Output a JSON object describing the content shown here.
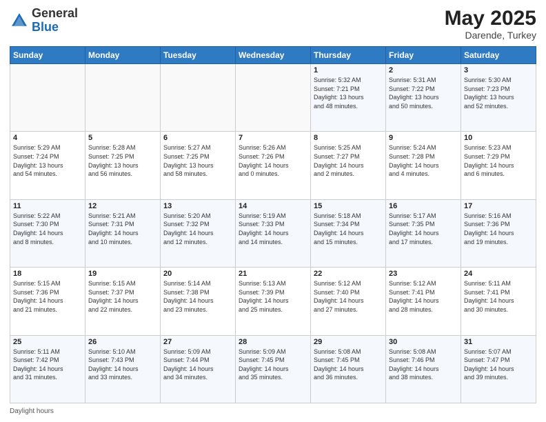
{
  "header": {
    "logo_general": "General",
    "logo_blue": "Blue",
    "title": "May 2025",
    "location": "Darende, Turkey"
  },
  "days_of_week": [
    "Sunday",
    "Monday",
    "Tuesday",
    "Wednesday",
    "Thursday",
    "Friday",
    "Saturday"
  ],
  "weeks": [
    [
      {
        "day": "",
        "info": ""
      },
      {
        "day": "",
        "info": ""
      },
      {
        "day": "",
        "info": ""
      },
      {
        "day": "",
        "info": ""
      },
      {
        "day": "1",
        "info": "Sunrise: 5:32 AM\nSunset: 7:21 PM\nDaylight: 13 hours\nand 48 minutes."
      },
      {
        "day": "2",
        "info": "Sunrise: 5:31 AM\nSunset: 7:22 PM\nDaylight: 13 hours\nand 50 minutes."
      },
      {
        "day": "3",
        "info": "Sunrise: 5:30 AM\nSunset: 7:23 PM\nDaylight: 13 hours\nand 52 minutes."
      }
    ],
    [
      {
        "day": "4",
        "info": "Sunrise: 5:29 AM\nSunset: 7:24 PM\nDaylight: 13 hours\nand 54 minutes."
      },
      {
        "day": "5",
        "info": "Sunrise: 5:28 AM\nSunset: 7:25 PM\nDaylight: 13 hours\nand 56 minutes."
      },
      {
        "day": "6",
        "info": "Sunrise: 5:27 AM\nSunset: 7:25 PM\nDaylight: 13 hours\nand 58 minutes."
      },
      {
        "day": "7",
        "info": "Sunrise: 5:26 AM\nSunset: 7:26 PM\nDaylight: 14 hours\nand 0 minutes."
      },
      {
        "day": "8",
        "info": "Sunrise: 5:25 AM\nSunset: 7:27 PM\nDaylight: 14 hours\nand 2 minutes."
      },
      {
        "day": "9",
        "info": "Sunrise: 5:24 AM\nSunset: 7:28 PM\nDaylight: 14 hours\nand 4 minutes."
      },
      {
        "day": "10",
        "info": "Sunrise: 5:23 AM\nSunset: 7:29 PM\nDaylight: 14 hours\nand 6 minutes."
      }
    ],
    [
      {
        "day": "11",
        "info": "Sunrise: 5:22 AM\nSunset: 7:30 PM\nDaylight: 14 hours\nand 8 minutes."
      },
      {
        "day": "12",
        "info": "Sunrise: 5:21 AM\nSunset: 7:31 PM\nDaylight: 14 hours\nand 10 minutes."
      },
      {
        "day": "13",
        "info": "Sunrise: 5:20 AM\nSunset: 7:32 PM\nDaylight: 14 hours\nand 12 minutes."
      },
      {
        "day": "14",
        "info": "Sunrise: 5:19 AM\nSunset: 7:33 PM\nDaylight: 14 hours\nand 14 minutes."
      },
      {
        "day": "15",
        "info": "Sunrise: 5:18 AM\nSunset: 7:34 PM\nDaylight: 14 hours\nand 15 minutes."
      },
      {
        "day": "16",
        "info": "Sunrise: 5:17 AM\nSunset: 7:35 PM\nDaylight: 14 hours\nand 17 minutes."
      },
      {
        "day": "17",
        "info": "Sunrise: 5:16 AM\nSunset: 7:36 PM\nDaylight: 14 hours\nand 19 minutes."
      }
    ],
    [
      {
        "day": "18",
        "info": "Sunrise: 5:15 AM\nSunset: 7:36 PM\nDaylight: 14 hours\nand 21 minutes."
      },
      {
        "day": "19",
        "info": "Sunrise: 5:15 AM\nSunset: 7:37 PM\nDaylight: 14 hours\nand 22 minutes."
      },
      {
        "day": "20",
        "info": "Sunrise: 5:14 AM\nSunset: 7:38 PM\nDaylight: 14 hours\nand 23 minutes."
      },
      {
        "day": "21",
        "info": "Sunrise: 5:13 AM\nSunset: 7:39 PM\nDaylight: 14 hours\nand 25 minutes."
      },
      {
        "day": "22",
        "info": "Sunrise: 5:12 AM\nSunset: 7:40 PM\nDaylight: 14 hours\nand 27 minutes."
      },
      {
        "day": "23",
        "info": "Sunrise: 5:12 AM\nSunset: 7:41 PM\nDaylight: 14 hours\nand 28 minutes."
      },
      {
        "day": "24",
        "info": "Sunrise: 5:11 AM\nSunset: 7:41 PM\nDaylight: 14 hours\nand 30 minutes."
      }
    ],
    [
      {
        "day": "25",
        "info": "Sunrise: 5:11 AM\nSunset: 7:42 PM\nDaylight: 14 hours\nand 31 minutes."
      },
      {
        "day": "26",
        "info": "Sunrise: 5:10 AM\nSunset: 7:43 PM\nDaylight: 14 hours\nand 33 minutes."
      },
      {
        "day": "27",
        "info": "Sunrise: 5:09 AM\nSunset: 7:44 PM\nDaylight: 14 hours\nand 34 minutes."
      },
      {
        "day": "28",
        "info": "Sunrise: 5:09 AM\nSunset: 7:45 PM\nDaylight: 14 hours\nand 35 minutes."
      },
      {
        "day": "29",
        "info": "Sunrise: 5:08 AM\nSunset: 7:45 PM\nDaylight: 14 hours\nand 36 minutes."
      },
      {
        "day": "30",
        "info": "Sunrise: 5:08 AM\nSunset: 7:46 PM\nDaylight: 14 hours\nand 38 minutes."
      },
      {
        "day": "31",
        "info": "Sunrise: 5:07 AM\nSunset: 7:47 PM\nDaylight: 14 hours\nand 39 minutes."
      }
    ]
  ],
  "footer": {
    "daylight_hours": "Daylight hours"
  }
}
